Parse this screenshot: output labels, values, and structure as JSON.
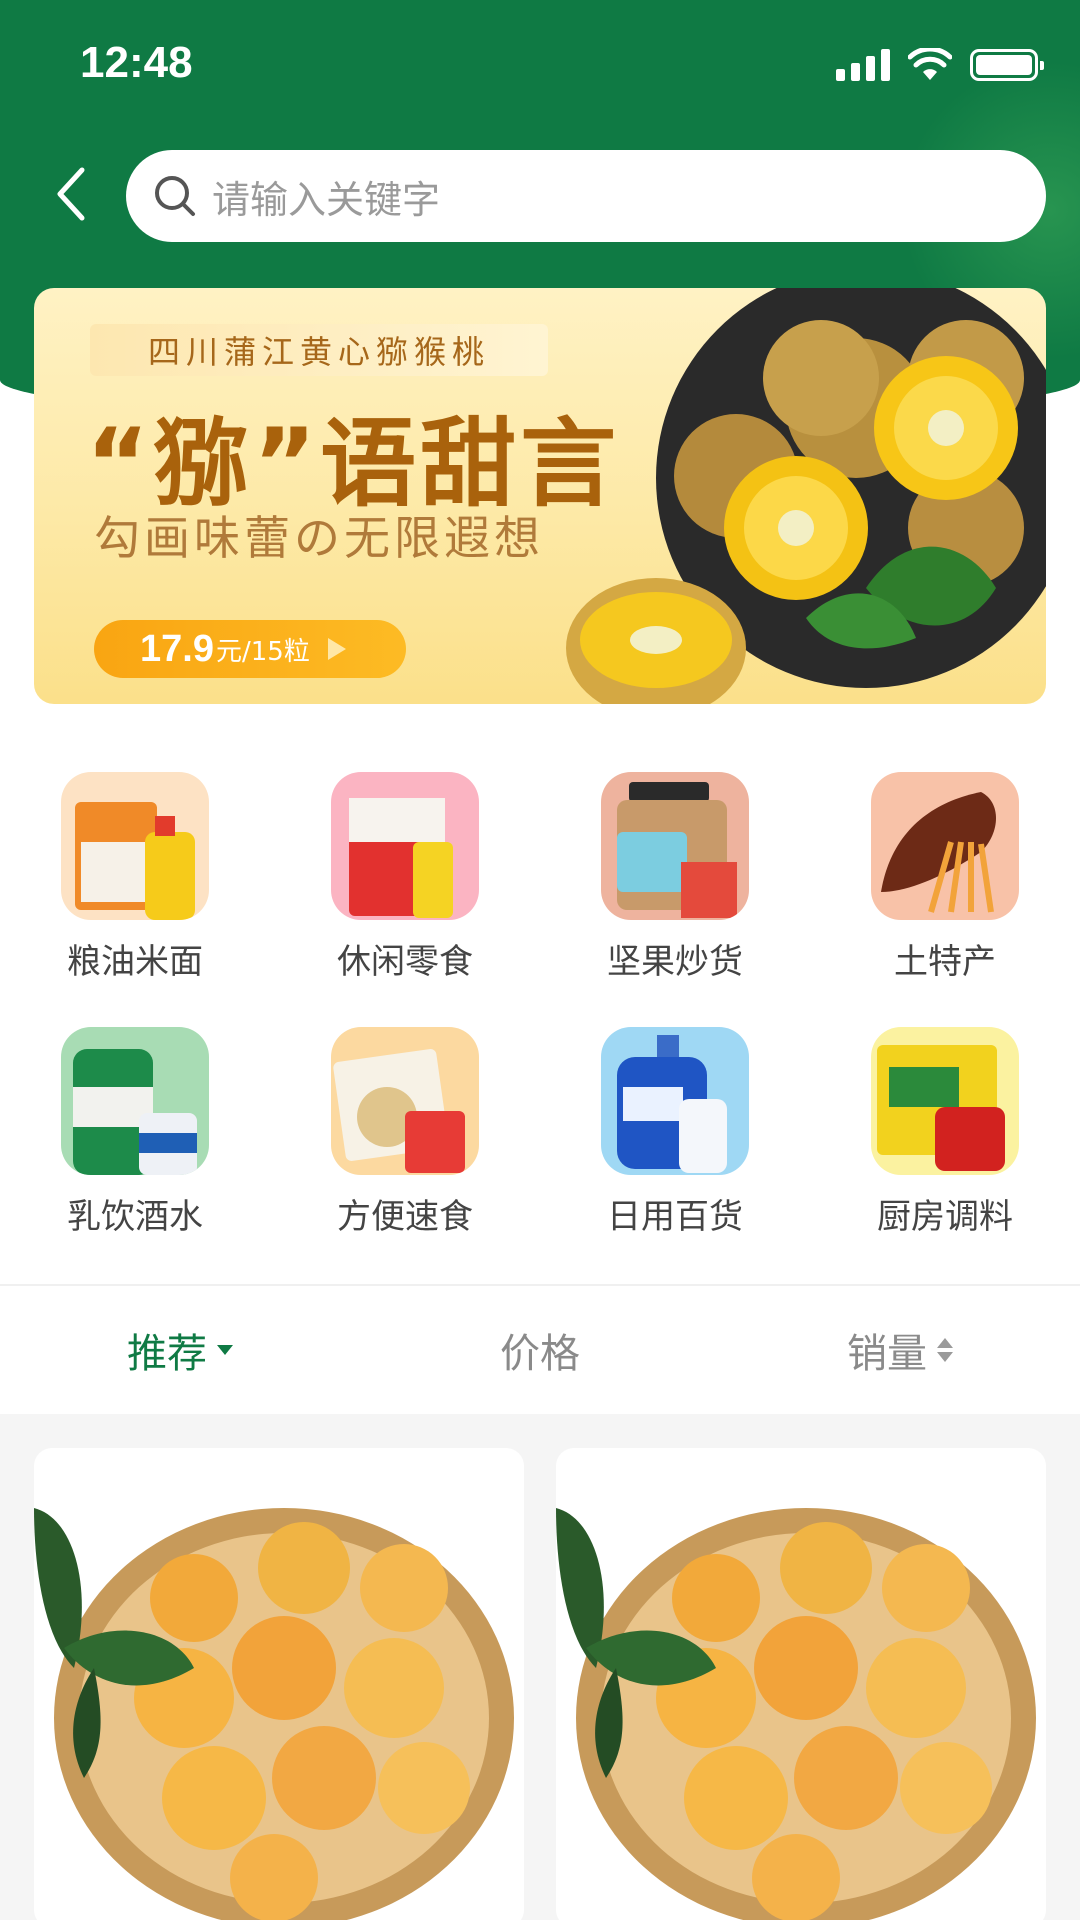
{
  "status_bar": {
    "time": "12:48"
  },
  "search": {
    "placeholder": "请输入关键字"
  },
  "banner": {
    "tag": "四川蒲江黄心猕猴桃",
    "title": "“猕”语甜言",
    "subtitle": "勾画味蕾の无限遐想",
    "price": "17.9",
    "price_unit": "元/15粒"
  },
  "categories": [
    {
      "label": "粮油米面",
      "icon": "grain-oil-icon"
    },
    {
      "label": "休闲零食",
      "icon": "snacks-icon"
    },
    {
      "label": "坚果炒货",
      "icon": "nuts-icon"
    },
    {
      "label": "土特产",
      "icon": "local-specialty-icon"
    },
    {
      "label": "乳饮酒水",
      "icon": "drinks-icon"
    },
    {
      "label": "方便速食",
      "icon": "instant-food-icon"
    },
    {
      "label": "日用百货",
      "icon": "daily-goods-icon"
    },
    {
      "label": "厨房调料",
      "icon": "seasoning-icon"
    }
  ],
  "sort": {
    "recommend": "推荐",
    "price": "价格",
    "sales": "销量"
  },
  "colors": {
    "brand_green": "#0f7a44",
    "banner_gold": "#a9620c",
    "price_orange": "#f9a512"
  }
}
